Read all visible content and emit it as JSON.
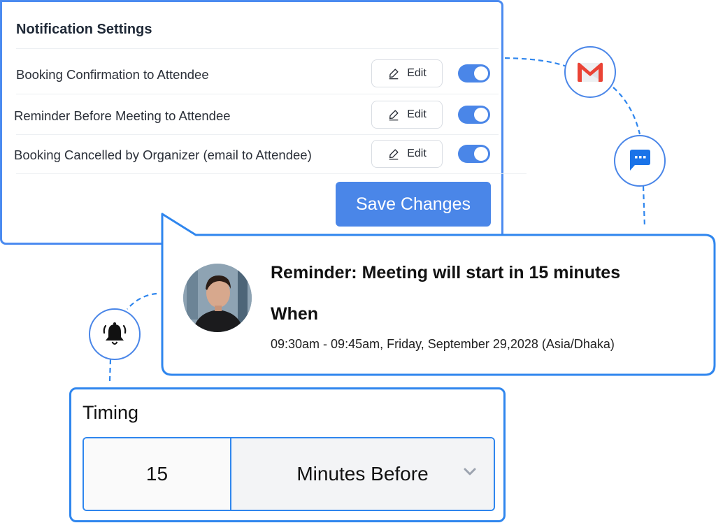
{
  "settings": {
    "title": "Notification Settings",
    "rows": [
      {
        "label": "Booking Confirmation to Attendee",
        "edit_label": "Edit",
        "enabled": true
      },
      {
        "label": "Reminder Before Meeting to Attendee",
        "edit_label": "Edit",
        "enabled": true
      },
      {
        "label": "Booking Cancelled by Organizer (email to Attendee)",
        "edit_label": "Edit",
        "enabled": true
      }
    ],
    "save_label": "Save Changes"
  },
  "reminder": {
    "title": "Reminder: Meeting will start in 15 minutes",
    "when_label": "When",
    "when_value": "09:30am  - 09:45am, Friday, September 29,2028 (Asia/Dhaka)"
  },
  "channels": {
    "icons": [
      "gmail-icon",
      "chat-message-icon",
      "bell-icon"
    ]
  },
  "timing": {
    "title": "Timing",
    "amount": "15",
    "unit": "Minutes Before"
  },
  "colors": {
    "accent": "#4a86e8",
    "border_accent": "#2f86ee",
    "gmail_red": "#ea4335",
    "chat_blue": "#1a73e8"
  }
}
